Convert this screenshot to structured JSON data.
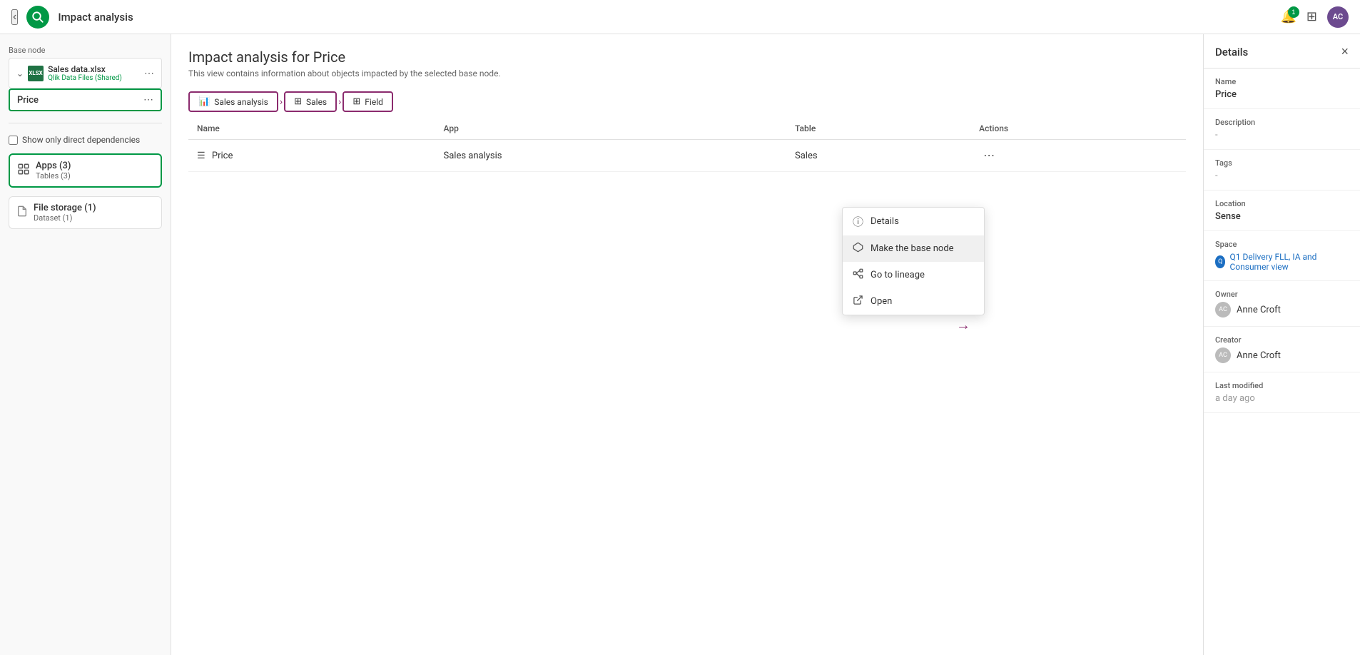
{
  "topbar": {
    "title": "Impact analysis",
    "logo_text": "Q",
    "notification_count": "1",
    "avatar_text": "AC"
  },
  "sidebar": {
    "base_node_label": "Base node",
    "file_name": "Sales data.xlsx",
    "file_path": "Qlik Data Files (Shared)",
    "price_label": "Price",
    "checkbox_label": "Show only direct dependencies",
    "apps_title": "Apps",
    "apps_count": "(3)",
    "apps_sub": "Tables (3)",
    "file_storage_title": "File storage",
    "file_storage_count": "(1)",
    "file_storage_sub": "Dataset (1)"
  },
  "content": {
    "title": "Impact analysis for Price",
    "subtitle": "This view contains information about objects impacted by the selected base node.",
    "breadcrumb": [
      {
        "label": "Sales analysis",
        "icon": "📊"
      },
      {
        "label": "Sales",
        "icon": "⊞"
      },
      {
        "label": "Field",
        "icon": "⊞"
      }
    ],
    "table": {
      "columns": [
        "Name",
        "App",
        "Table",
        "Actions"
      ],
      "rows": [
        {
          "name": "Price",
          "app": "Sales analysis",
          "table": "Sales",
          "icon": "≡"
        }
      ]
    }
  },
  "dropdown": {
    "items": [
      {
        "label": "Details",
        "icon": "ℹ"
      },
      {
        "label": "Make the base node",
        "icon": "⬡"
      },
      {
        "label": "Go to lineage",
        "icon": "⬡"
      },
      {
        "label": "Open",
        "icon": "⬡"
      }
    ]
  },
  "details_panel": {
    "title": "Details",
    "name_label": "Name",
    "name_value": "Price",
    "description_label": "Description",
    "description_value": "-",
    "tags_label": "Tags",
    "tags_value": "-",
    "location_label": "Location",
    "location_value": "Sense",
    "space_label": "Space",
    "space_value": "Q1 Delivery FLL, IA and Consumer view",
    "owner_label": "Owner",
    "owner_name": "Anne Croft",
    "creator_label": "Creator",
    "creator_name": "Anne Croft",
    "last_modified_label": "Last modified",
    "last_modified_value": "a day ago"
  }
}
